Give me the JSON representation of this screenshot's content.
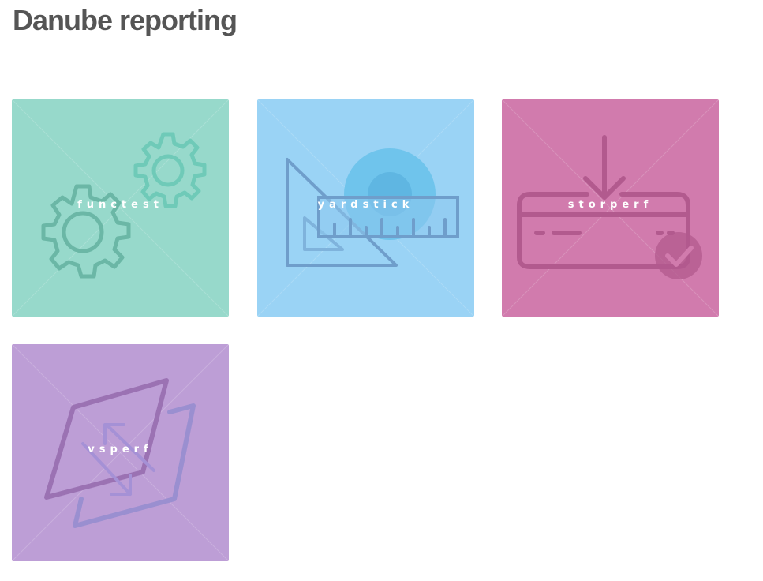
{
  "page": {
    "title": "Danube reporting"
  },
  "tiles": [
    {
      "id": "functest",
      "label": "functest",
      "color": "#97d9cb",
      "icon": "gears-icon"
    },
    {
      "id": "yardstick",
      "label": "yardstick",
      "color": "#9ad3f5",
      "icon": "ruler-set-square-icon"
    },
    {
      "id": "storperf",
      "label": "storperf",
      "color": "#d17bad",
      "icon": "storage-download-icon"
    },
    {
      "id": "vsperf",
      "label": "vsperf",
      "color": "#bd9ed6",
      "icon": "vswitch-arrows-icon"
    }
  ]
}
